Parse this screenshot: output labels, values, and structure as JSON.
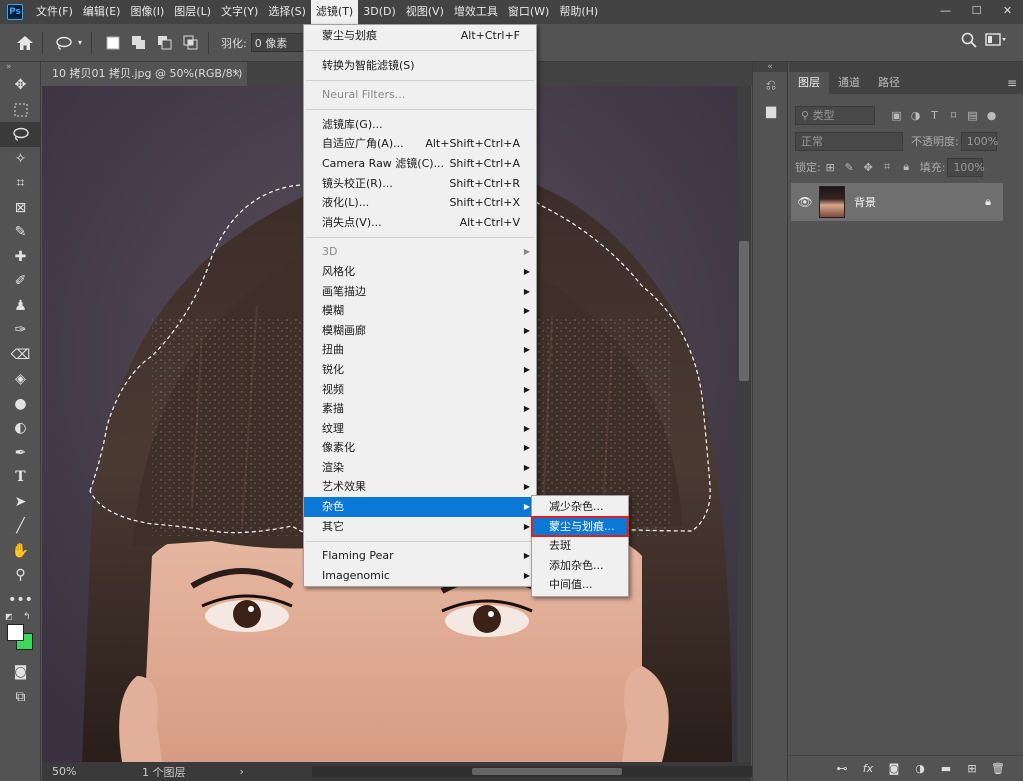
{
  "app": {
    "logo": "Ps"
  },
  "menubar": {
    "items": [
      "文件(F)",
      "编辑(E)",
      "图像(I)",
      "图层(L)",
      "文字(Y)",
      "选择(S)",
      "滤镜(T)",
      "3D(D)",
      "视图(V)",
      "增效工具",
      "窗口(W)",
      "帮助(H)"
    ],
    "active": "滤镜(T)"
  },
  "window_controls": {
    "minimize": "—",
    "restore": "☐",
    "close": "✕"
  },
  "options": {
    "feather_label": "羽化:",
    "feather_value": "0 像素"
  },
  "document": {
    "tab_title": "10 拷贝01 拷贝.jpg @ 50%(RGB/8*)",
    "tab_close": "×"
  },
  "status": {
    "zoom": "50%",
    "layers": "1 个图层",
    "arrow": "›"
  },
  "filter_menu": {
    "groups": [
      [
        {
          "label": "蒙尘与划痕",
          "shortcut": "Alt+Ctrl+F"
        }
      ],
      [
        {
          "label": "转换为智能滤镜(S)"
        }
      ],
      [
        {
          "label": "Neural Filters...",
          "disabled": true
        }
      ],
      [
        {
          "label": "滤镜库(G)..."
        },
        {
          "label": "自适应广角(A)...",
          "shortcut": "Alt+Shift+Ctrl+A"
        },
        {
          "label": "Camera Raw 滤镜(C)...",
          "shortcut": "Shift+Ctrl+A"
        },
        {
          "label": "镜头校正(R)...",
          "shortcut": "Shift+Ctrl+R"
        },
        {
          "label": "液化(L)...",
          "shortcut": "Shift+Ctrl+X"
        },
        {
          "label": "消失点(V)...",
          "shortcut": "Alt+Ctrl+V"
        }
      ],
      [
        {
          "label": "3D",
          "disabled": true,
          "submenu": true
        },
        {
          "label": "风格化",
          "submenu": true
        },
        {
          "label": "画笔描边",
          "submenu": true
        },
        {
          "label": "模糊",
          "submenu": true
        },
        {
          "label": "模糊画廊",
          "submenu": true
        },
        {
          "label": "扭曲",
          "submenu": true
        },
        {
          "label": "锐化",
          "submenu": true
        },
        {
          "label": "视频",
          "submenu": true
        },
        {
          "label": "素描",
          "submenu": true
        },
        {
          "label": "纹理",
          "submenu": true
        },
        {
          "label": "像素化",
          "submenu": true
        },
        {
          "label": "渲染",
          "submenu": true
        },
        {
          "label": "艺术效果",
          "submenu": true
        },
        {
          "label": "杂色",
          "submenu": true,
          "highlighted": true
        },
        {
          "label": "其它",
          "submenu": true
        }
      ],
      [
        {
          "label": "Flaming Pear",
          "submenu": true
        },
        {
          "label": "Imagenomic",
          "submenu": true
        }
      ]
    ]
  },
  "noise_submenu": {
    "items": [
      {
        "label": "减少杂色..."
      },
      {
        "label": "蒙尘与划痕...",
        "highlighted": true
      },
      {
        "label": "去斑"
      },
      {
        "label": "添加杂色..."
      },
      {
        "label": "中间值..."
      }
    ]
  },
  "layers_panel": {
    "tabs": [
      "图层",
      "通道",
      "路径"
    ],
    "active_tab": "图层",
    "filter_placeholder": "类型",
    "blend_mode": "正常",
    "opacity_label": "不透明度:",
    "opacity_value": "100%",
    "lock_label": "锁定:",
    "fill_label": "填充:",
    "fill_value": "100%",
    "layers": [
      {
        "name": "背景",
        "visible": true,
        "locked": true
      }
    ]
  },
  "icons": {
    "home": "home-icon",
    "lasso": "lasso-icon",
    "search": "search-icon",
    "eye": "eye-icon",
    "lock": "lock-icon"
  }
}
